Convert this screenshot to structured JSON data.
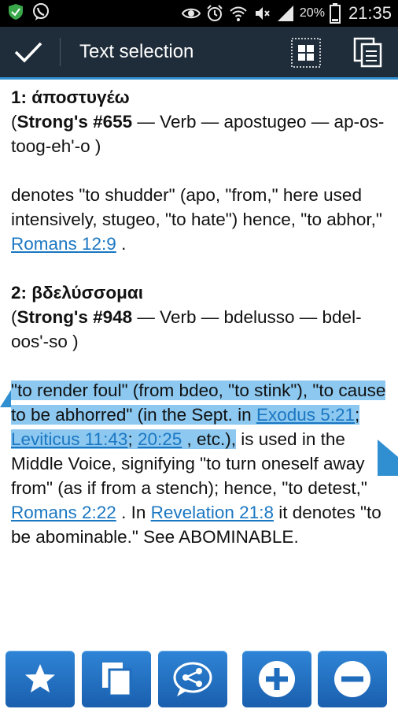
{
  "status_bar": {
    "time": "21:35",
    "battery": "20%",
    "icons": [
      "shield-icon",
      "viber-icon",
      "eye-icon",
      "alarm-icon",
      "wifi-icon",
      "mute-icon",
      "signal-icon",
      "battery-icon"
    ]
  },
  "action_bar": {
    "title": "Text selection",
    "icons": [
      "check-icon",
      "select-all-icon",
      "copy-icon"
    ]
  },
  "content": {
    "entry1": {
      "heading": "1: άποστυγέω",
      "strongs_open": "(",
      "strongs_label": "Strong's #655",
      "strongs_rest": " — Verb — apostugeo — ap-os-toog-eh'-o )",
      "definition_text": "denotes \"to shudder\" (apo, \"from,\" here used intensively, stugeo, \"to hate\") hence, \"to abhor,\" ",
      "definition_link": "Romans 12:9",
      "definition_end": " ."
    },
    "entry2": {
      "heading": "2: βδελύσσομαι",
      "strongs_open": "(",
      "strongs_label": "Strong's #948",
      "strongs_rest": " — Verb — bdelusso — bdel-oos'-so )",
      "selected_text": "\"to render foul\" (from bdeo, \"to stink\"), \"to cause to be abhorred\" (in the Sept. in ",
      "link_exodus": "Exodus 5:21",
      "sep1": "; ",
      "link_leviticus": "Leviticus 11:43",
      "sep2": "; ",
      "link_2025": "20:25",
      "selected_end": " , etc.),",
      "rest_text": " is used in the Middle Voice, signifying \"to turn oneself away from\" (as if from a stench); hence, \"to detest,\" ",
      "link_romans": "Romans 2:22",
      "rest_mid": " . In ",
      "link_revelation": "Revelation 21:8",
      "rest_end": " it denotes \"to be abominable.\" See ABOMINABLE."
    }
  },
  "toolbar": {
    "buttons": [
      "star-icon",
      "copy-icon",
      "share-icon",
      "zoom-in-icon",
      "zoom-out-icon"
    ]
  },
  "colors": {
    "action_bar": "#1f2d3a",
    "accent_line": "#2f8fd1",
    "link": "#1b77c2",
    "selection": "#8cc8f0",
    "toolbar_button": "#2f84d6"
  }
}
